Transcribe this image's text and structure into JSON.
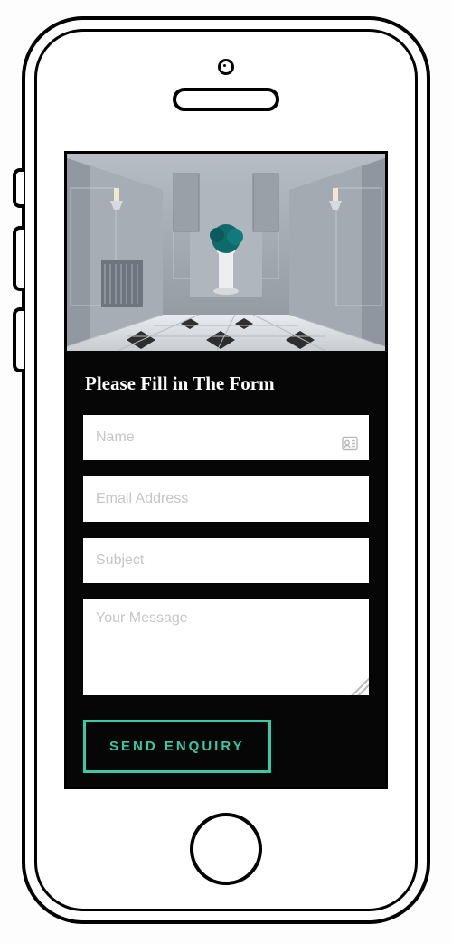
{
  "form": {
    "title": "Please Fill in The Form",
    "name_placeholder": "Name",
    "email_placeholder": "Email Address",
    "subject_placeholder": "Subject",
    "message_placeholder": "Your Message",
    "submit_label": "SEND ENQUIRY",
    "name_value": "",
    "email_value": "",
    "subject_value": "",
    "message_value": ""
  },
  "colors": {
    "panel_bg": "#060606",
    "accent": "#38c9a7",
    "placeholder": "#c6c6c6"
  }
}
